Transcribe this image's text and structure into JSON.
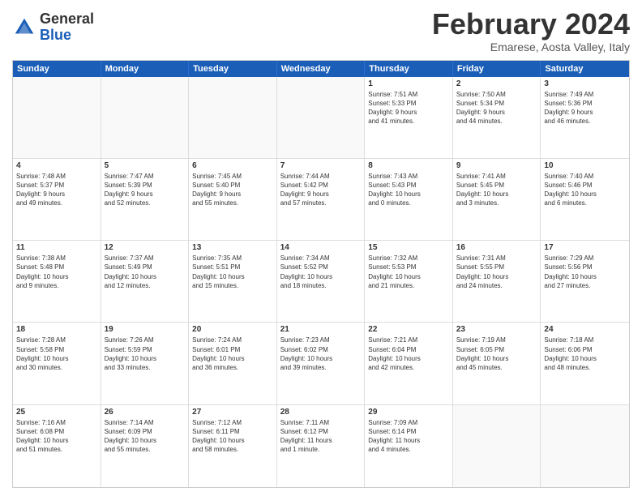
{
  "logo": {
    "general": "General",
    "blue": "Blue"
  },
  "title": {
    "month": "February 2024",
    "location": "Emarese, Aosta Valley, Italy"
  },
  "header_days": [
    "Sunday",
    "Monday",
    "Tuesday",
    "Wednesday",
    "Thursday",
    "Friday",
    "Saturday"
  ],
  "weeks": [
    [
      {
        "day": "",
        "info": ""
      },
      {
        "day": "",
        "info": ""
      },
      {
        "day": "",
        "info": ""
      },
      {
        "day": "",
        "info": ""
      },
      {
        "day": "1",
        "info": "Sunrise: 7:51 AM\nSunset: 5:33 PM\nDaylight: 9 hours\nand 41 minutes."
      },
      {
        "day": "2",
        "info": "Sunrise: 7:50 AM\nSunset: 5:34 PM\nDaylight: 9 hours\nand 44 minutes."
      },
      {
        "day": "3",
        "info": "Sunrise: 7:49 AM\nSunset: 5:36 PM\nDaylight: 9 hours\nand 46 minutes."
      }
    ],
    [
      {
        "day": "4",
        "info": "Sunrise: 7:48 AM\nSunset: 5:37 PM\nDaylight: 9 hours\nand 49 minutes."
      },
      {
        "day": "5",
        "info": "Sunrise: 7:47 AM\nSunset: 5:39 PM\nDaylight: 9 hours\nand 52 minutes."
      },
      {
        "day": "6",
        "info": "Sunrise: 7:45 AM\nSunset: 5:40 PM\nDaylight: 9 hours\nand 55 minutes."
      },
      {
        "day": "7",
        "info": "Sunrise: 7:44 AM\nSunset: 5:42 PM\nDaylight: 9 hours\nand 57 minutes."
      },
      {
        "day": "8",
        "info": "Sunrise: 7:43 AM\nSunset: 5:43 PM\nDaylight: 10 hours\nand 0 minutes."
      },
      {
        "day": "9",
        "info": "Sunrise: 7:41 AM\nSunset: 5:45 PM\nDaylight: 10 hours\nand 3 minutes."
      },
      {
        "day": "10",
        "info": "Sunrise: 7:40 AM\nSunset: 5:46 PM\nDaylight: 10 hours\nand 6 minutes."
      }
    ],
    [
      {
        "day": "11",
        "info": "Sunrise: 7:38 AM\nSunset: 5:48 PM\nDaylight: 10 hours\nand 9 minutes."
      },
      {
        "day": "12",
        "info": "Sunrise: 7:37 AM\nSunset: 5:49 PM\nDaylight: 10 hours\nand 12 minutes."
      },
      {
        "day": "13",
        "info": "Sunrise: 7:35 AM\nSunset: 5:51 PM\nDaylight: 10 hours\nand 15 minutes."
      },
      {
        "day": "14",
        "info": "Sunrise: 7:34 AM\nSunset: 5:52 PM\nDaylight: 10 hours\nand 18 minutes."
      },
      {
        "day": "15",
        "info": "Sunrise: 7:32 AM\nSunset: 5:53 PM\nDaylight: 10 hours\nand 21 minutes."
      },
      {
        "day": "16",
        "info": "Sunrise: 7:31 AM\nSunset: 5:55 PM\nDaylight: 10 hours\nand 24 minutes."
      },
      {
        "day": "17",
        "info": "Sunrise: 7:29 AM\nSunset: 5:56 PM\nDaylight: 10 hours\nand 27 minutes."
      }
    ],
    [
      {
        "day": "18",
        "info": "Sunrise: 7:28 AM\nSunset: 5:58 PM\nDaylight: 10 hours\nand 30 minutes."
      },
      {
        "day": "19",
        "info": "Sunrise: 7:26 AM\nSunset: 5:59 PM\nDaylight: 10 hours\nand 33 minutes."
      },
      {
        "day": "20",
        "info": "Sunrise: 7:24 AM\nSunset: 6:01 PM\nDaylight: 10 hours\nand 36 minutes."
      },
      {
        "day": "21",
        "info": "Sunrise: 7:23 AM\nSunset: 6:02 PM\nDaylight: 10 hours\nand 39 minutes."
      },
      {
        "day": "22",
        "info": "Sunrise: 7:21 AM\nSunset: 6:04 PM\nDaylight: 10 hours\nand 42 minutes."
      },
      {
        "day": "23",
        "info": "Sunrise: 7:19 AM\nSunset: 6:05 PM\nDaylight: 10 hours\nand 45 minutes."
      },
      {
        "day": "24",
        "info": "Sunrise: 7:18 AM\nSunset: 6:06 PM\nDaylight: 10 hours\nand 48 minutes."
      }
    ],
    [
      {
        "day": "25",
        "info": "Sunrise: 7:16 AM\nSunset: 6:08 PM\nDaylight: 10 hours\nand 51 minutes."
      },
      {
        "day": "26",
        "info": "Sunrise: 7:14 AM\nSunset: 6:09 PM\nDaylight: 10 hours\nand 55 minutes."
      },
      {
        "day": "27",
        "info": "Sunrise: 7:12 AM\nSunset: 6:11 PM\nDaylight: 10 hours\nand 58 minutes."
      },
      {
        "day": "28",
        "info": "Sunrise: 7:11 AM\nSunset: 6:12 PM\nDaylight: 11 hours\nand 1 minute."
      },
      {
        "day": "29",
        "info": "Sunrise: 7:09 AM\nSunset: 6:14 PM\nDaylight: 11 hours\nand 4 minutes."
      },
      {
        "day": "",
        "info": ""
      },
      {
        "day": "",
        "info": ""
      }
    ]
  ]
}
